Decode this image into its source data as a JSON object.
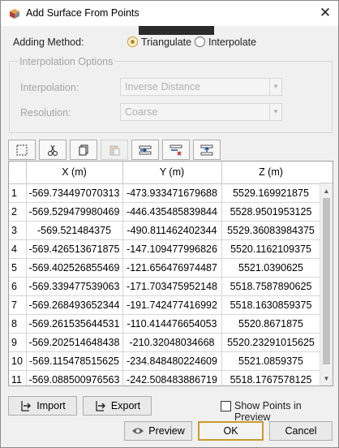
{
  "window": {
    "title": "Add Surface From Points",
    "close_glyph": "✕"
  },
  "adding_method": {
    "label": "Adding Method:",
    "options": [
      {
        "label": "Triangulate",
        "selected": true
      },
      {
        "label": "Interpolate",
        "selected": false
      }
    ]
  },
  "interpolation_options": {
    "title": "Interpolation Options",
    "interpolation_label": "Interpolation:",
    "interpolation_value": "Inverse Distance",
    "resolution_label": "Resolution:",
    "resolution_value": "Coarse"
  },
  "toolbar": {
    "icons": [
      "select-all-icon",
      "cut-icon",
      "copy-icon",
      "paste-icon",
      "insert-row-icon",
      "delete-row-icon",
      "import-rows-icon"
    ]
  },
  "grid": {
    "columns": [
      "X (m)",
      "Y (m)",
      "Z (m)"
    ],
    "rows": [
      [
        "1",
        "-569.734497070313",
        "-473.933471679688",
        "5529.169921875"
      ],
      [
        "2",
        "-569.529479980469",
        "-446.435485839844",
        "5528.9501953125"
      ],
      [
        "3",
        "-569.521484375",
        "-490.811462402344",
        "5529.36083984375"
      ],
      [
        "4",
        "-569.426513671875",
        "-147.109477996826",
        "5520.1162109375"
      ],
      [
        "5",
        "-569.402526855469",
        "-121.656476974487",
        "5521.0390625"
      ],
      [
        "6",
        "-569.339477539063",
        "-171.703475952148",
        "5518.7587890625"
      ],
      [
        "7",
        "-569.268493652344",
        "-191.742477416992",
        "5518.1630859375"
      ],
      [
        "8",
        "-569.261535644531",
        "-110.414476654053",
        "5520.8671875"
      ],
      [
        "9",
        "-569.202514648438",
        "-210.32048034668",
        "5520.23291015625"
      ],
      [
        "10",
        "-569.115478515625",
        "-234.848480224609",
        "5521.0859375"
      ],
      [
        "11",
        "-569.088500976563",
        "-242.508483886719",
        "5518.1767578125"
      ]
    ]
  },
  "footer": {
    "import_label": "Import",
    "export_label": "Export",
    "show_points_label": "Show Points in Preview",
    "show_points_checked": false,
    "preview_label": "Preview",
    "ok_label": "OK",
    "cancel_label": "Cancel"
  },
  "colors": {
    "accent": "#c99a2e",
    "disabled_text": "#a4a4a4"
  }
}
